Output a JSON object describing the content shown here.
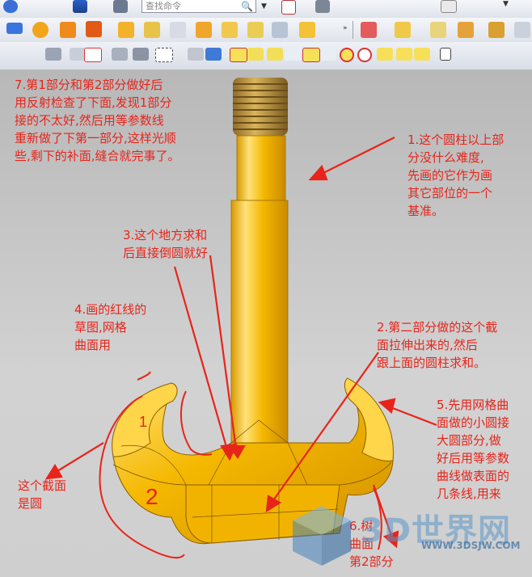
{
  "toolbar": {
    "find_placeholder": "查找命令",
    "combo_value": ""
  },
  "annotations": {
    "note1": "1.这个圆柱以上部\n分没什么难度,\n先画的它作为画\n其它部位的一个\n基准。",
    "note2": "2.第二部分做的这个截\n面拉伸出来的,然后\n跟上面的圆柱求和。",
    "note3": "3.这个地方求和\n后直接倒圆就好",
    "note4": "4.画的红线的\n草图,网格\n曲面用",
    "note5": "5.先用网格曲\n面做的小圆接\n大圆部分,做\n好后用等参数\n曲线做表面的\n几条线,用来",
    "note6": "6.树\n曲面\n第2部分",
    "note7": "7.第1部分和第2部分做好后\n用反射检查了下面,发现1部分\n接的不太好,然后用等参数线\n重新做了下第一部分,这样光顺\n些,剩下的补面,缝合就完事了。",
    "section_note": "这个截面\n是圆",
    "sketch_label_1": "1",
    "sketch_label_2": "2"
  },
  "watermark": {
    "title": "3D世界网",
    "url": "WWW.3DSJW.COM"
  },
  "colors": {
    "annotation_red": "#e8241a",
    "hook_yellow": "#f5b800",
    "hook_highlight": "#ffe27a",
    "arrow_red": "#e8241a"
  }
}
